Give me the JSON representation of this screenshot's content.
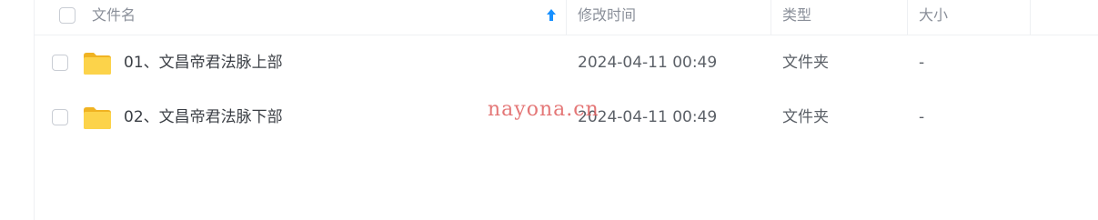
{
  "header": {
    "name": "文件名",
    "modified": "修改时间",
    "type": "类型",
    "size": "大小"
  },
  "files": [
    {
      "name": "01、文昌帝君法脉上部",
      "modified": "2024-04-11 00:49",
      "type": "文件夹",
      "size": "-"
    },
    {
      "name": "02、文昌帝君法脉下部",
      "modified": "2024-04-11 00:49",
      "type": "文件夹",
      "size": "-"
    }
  ],
  "watermark": "nayona.cn",
  "colors": {
    "accent": "#1890ff",
    "folder": "#f7c42d",
    "text": "#3b3f45",
    "header_text": "#8a8f99"
  }
}
